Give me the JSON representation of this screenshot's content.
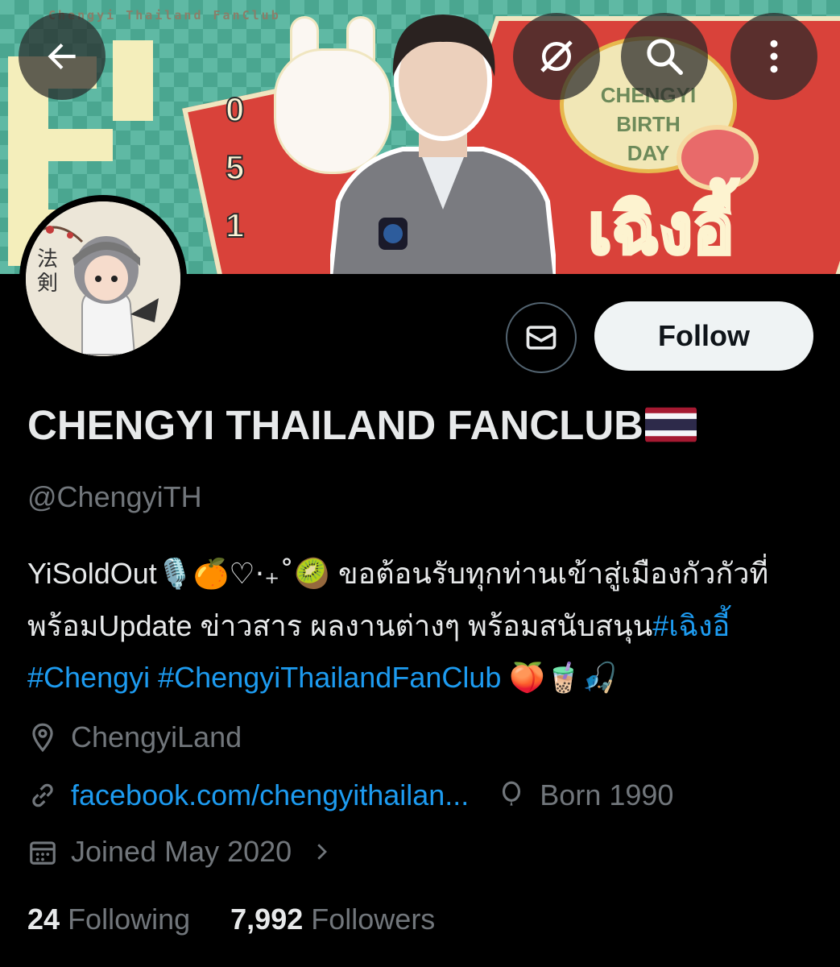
{
  "banner": {
    "caption": "Chengyi Thailand FanClub",
    "badge_line1": "CHENGYI",
    "badge_line2": "BIRTH",
    "badge_line3": "DAY",
    "thai_name": "เฉิงอี้",
    "vertical_digits": "0 5 1"
  },
  "toolbar": {
    "back_icon": "arrow-left-icon",
    "share_icon": "broadcast-off-icon",
    "search_icon": "search-icon",
    "more_icon": "more-vertical-icon"
  },
  "profile": {
    "display_name": "CHENGYI THAILAND FANCLUB",
    "handle": "@ChengyiTH",
    "follow_label": "Follow",
    "bio": {
      "part1": "YiSoldOut",
      "emoji1": "🎙️🍊♡·₊˚🥝",
      "part2": " ขอต้อนรับทุกท่านเข้าสู่เมืองกัวกัวที่พร้อมUpdate ข่าวสาร ผลงานต่างๆ พร้อมสนับสนุน",
      "tag1": "#เฉิงอี้",
      "tag2": "#Chengyi",
      "tag3": "#ChengyiThailandFanClub",
      "emoji2": "🍑🧋🎣"
    },
    "location": "ChengyiLand",
    "website": "facebook.com/chengyithailan...",
    "birth": "Born 1990",
    "joined": "Joined May 2020",
    "following_count": "24",
    "following_label": "Following",
    "followers_count": "7,992",
    "followers_label": "Followers"
  },
  "colors": {
    "background": "#000000",
    "text_primary": "#e7e9ea",
    "text_secondary": "#71767b",
    "link": "#1d9bf0",
    "follow_button_bg": "#eff3f4"
  }
}
